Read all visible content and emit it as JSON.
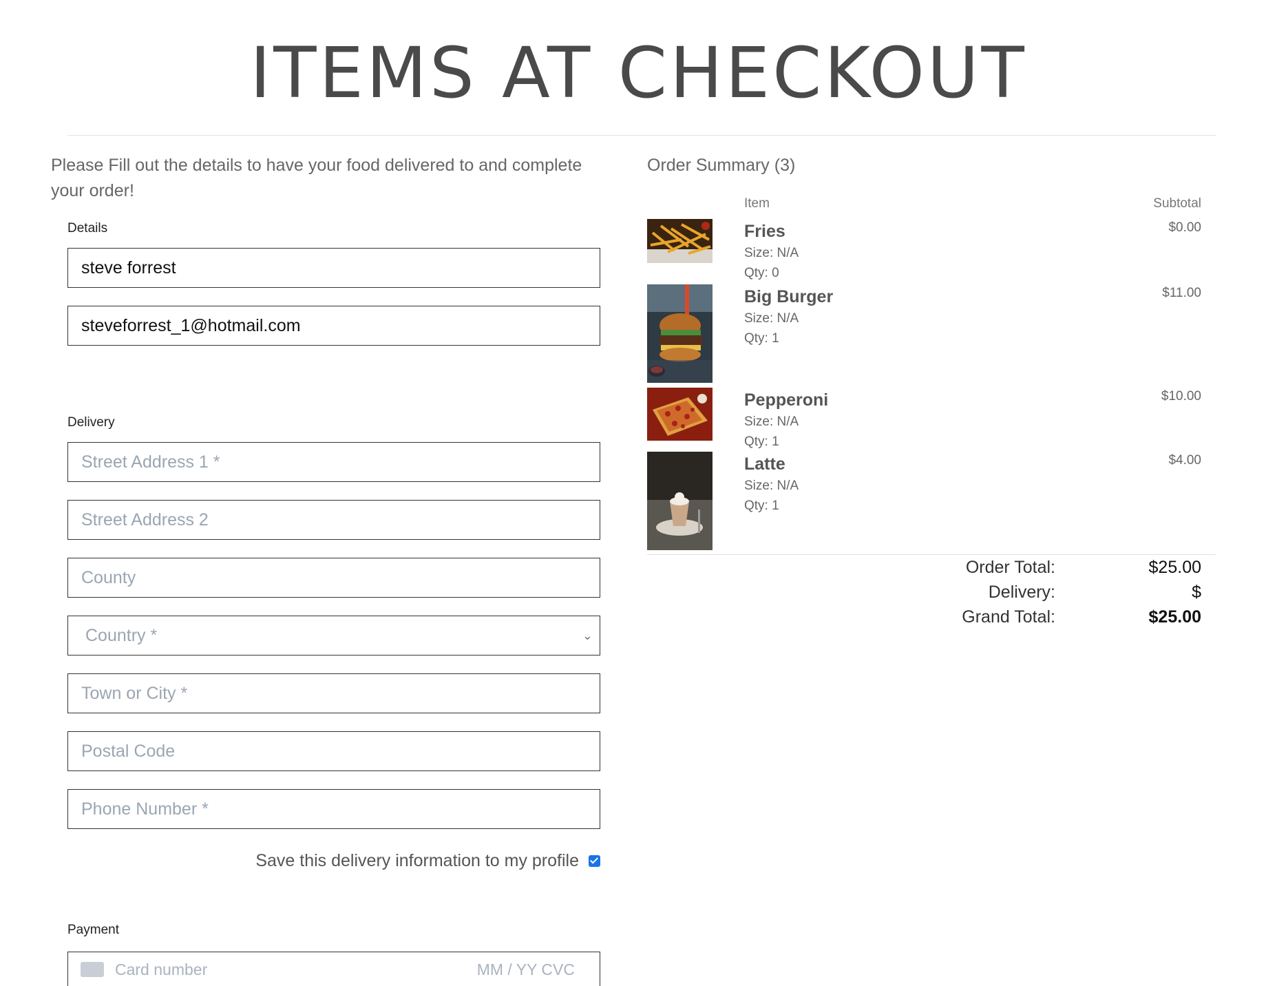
{
  "page": {
    "title": "ITEMS AT CHECKOUT",
    "intro": "Please Fill out the details to have your food delivered to and complete your order!"
  },
  "details": {
    "label": "Details",
    "full_name": "steve forrest",
    "email": "steveforrest_1@hotmail.com"
  },
  "delivery": {
    "label": "Delivery",
    "street1_placeholder": "Street Address 1 *",
    "street2_placeholder": "Street Address 2",
    "county_placeholder": "County",
    "country_selected": "Country *",
    "town_placeholder": "Town or City *",
    "postcode_placeholder": "Postal Code",
    "phone_placeholder": "Phone Number *",
    "save_label": "Save this delivery information to my profile",
    "save_checked": true
  },
  "payment": {
    "label": "Payment",
    "card_placeholder": "Card number",
    "expiry_cvc_placeholder": "MM / YY  CVC"
  },
  "summary": {
    "title": "Order Summary (3)",
    "col_item": "Item",
    "col_subtotal": "Subtotal",
    "items": [
      {
        "name": "Fries",
        "size": "Size: N/A",
        "qty": "Qty: 0",
        "price": "$0.00",
        "image": "fries-photo"
      },
      {
        "name": "Big Burger",
        "size": "Size: N/A",
        "qty": "Qty: 1",
        "price": "$11.00",
        "image": "burger-photo"
      },
      {
        "name": "Pepperoni",
        "size": "Size: N/A",
        "qty": "Qty: 1",
        "price": "$10.00",
        "image": "pizza-photo"
      },
      {
        "name": "Latte",
        "size": "Size: N/A",
        "qty": "Qty: 1",
        "price": "$4.00",
        "image": "latte-photo"
      }
    ],
    "order_total_label": "Order Total:",
    "order_total": "$25.00",
    "delivery_label": "Delivery:",
    "delivery_value": "$",
    "grand_total_label": "Grand Total:",
    "grand_total": "$25.00"
  }
}
